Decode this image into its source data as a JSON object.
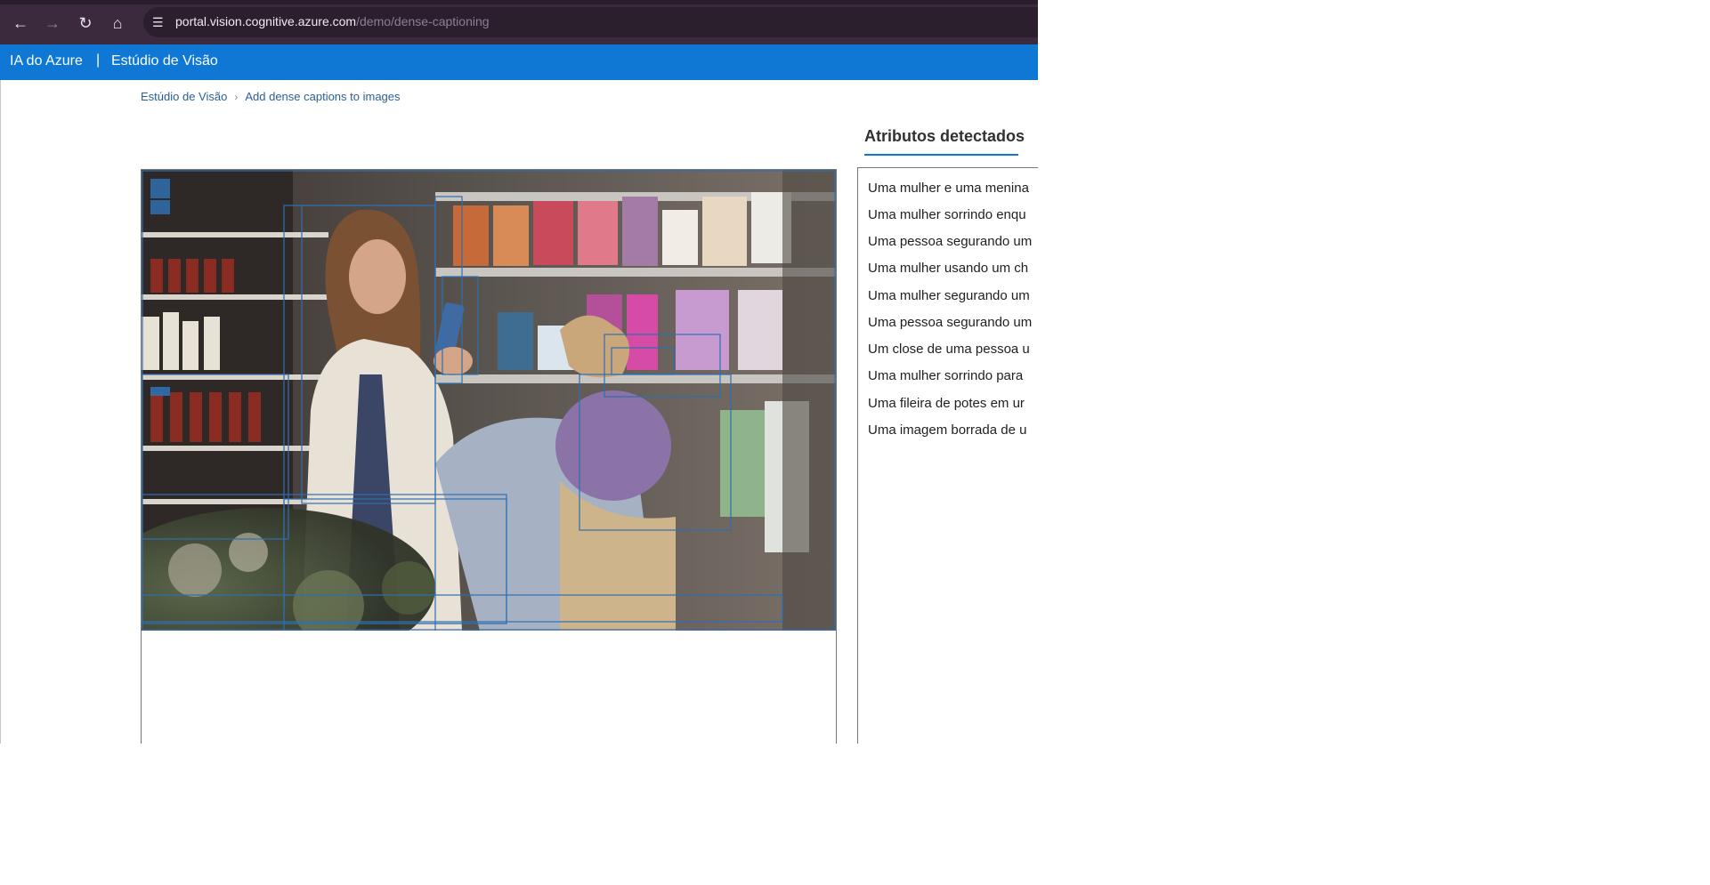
{
  "browser": {
    "url_host": "portal.vision.cognitive.azure.com",
    "url_path": "/demo/dense-captioning",
    "icons": [
      "back-arrow-icon",
      "forward-arrow-icon",
      "reload-icon",
      "home-icon",
      "site-settings-icon"
    ]
  },
  "header": {
    "brand": "IA do Azure",
    "separator": "|",
    "studio": "Estúdio de Visão"
  },
  "breadcrumb": {
    "items": [
      "Estúdio de Visão",
      "Add dense captions to images"
    ],
    "separator": ">"
  },
  "attributes": {
    "title": "Atributos detectados",
    "accent_color": "#0f78d4",
    "items": [
      "Uma mulher e uma menina",
      "Uma mulher sorrindo enqu",
      "Uma pessoa segurando um",
      "Uma mulher usando um ch",
      "Uma mulher segurando um",
      "Uma pessoa segurando um",
      "Um close de uma pessoa u",
      "Uma mulher sorrindo para",
      "Uma fileira de potes em ur",
      "Uma imagem borrada de u"
    ]
  },
  "colors": {
    "chrome": "#3b2a3e",
    "azure_header": "#0f78d4",
    "box_outline": "#2f6fb0"
  }
}
